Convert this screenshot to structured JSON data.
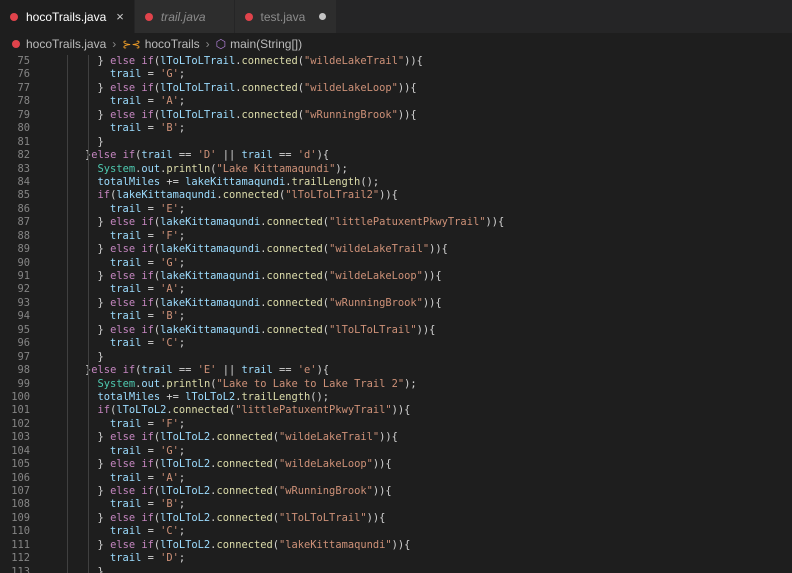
{
  "tabs": [
    {
      "label": "hocoTrails.java",
      "close": "×",
      "active": true
    },
    {
      "label": "trail.java",
      "active": false
    },
    {
      "label": "test.java",
      "active": false,
      "unsaved": true
    }
  ],
  "breadcrumb": {
    "file": "hocoTrails.java",
    "class": "hocoTrails",
    "method": "main(String[])"
  },
  "lines": [
    {
      "num": "75",
      "indent": "      ",
      "tokens": [
        [
          "op",
          "} "
        ],
        [
          "kw",
          "else if"
        ],
        [
          "op",
          "("
        ],
        [
          "var",
          "lToLToLTrail"
        ],
        [
          "op",
          "."
        ],
        [
          "fn",
          "connected"
        ],
        [
          "op",
          "("
        ],
        [
          "str",
          "\"wildeLakeTrail\""
        ],
        [
          "op",
          "))"
        ],
        [
          "op",
          "{"
        ]
      ]
    },
    {
      "num": "76",
      "indent": "        ",
      "tokens": [
        [
          "var",
          "trail"
        ],
        [
          "op",
          " = "
        ],
        [
          "str",
          "'G'"
        ],
        [
          "op",
          ";"
        ]
      ]
    },
    {
      "num": "77",
      "indent": "      ",
      "tokens": [
        [
          "op",
          "} "
        ],
        [
          "kw",
          "else if"
        ],
        [
          "op",
          "("
        ],
        [
          "var",
          "lToLToLTrail"
        ],
        [
          "op",
          "."
        ],
        [
          "fn",
          "connected"
        ],
        [
          "op",
          "("
        ],
        [
          "str",
          "\"wildeLakeLoop\""
        ],
        [
          "op",
          "))"
        ],
        [
          "op",
          "{"
        ]
      ]
    },
    {
      "num": "78",
      "indent": "        ",
      "tokens": [
        [
          "var",
          "trail"
        ],
        [
          "op",
          " = "
        ],
        [
          "str",
          "'A'"
        ],
        [
          "op",
          ";"
        ]
      ]
    },
    {
      "num": "79",
      "indent": "      ",
      "tokens": [
        [
          "op",
          "} "
        ],
        [
          "kw",
          "else if"
        ],
        [
          "op",
          "("
        ],
        [
          "var",
          "lToLToLTrail"
        ],
        [
          "op",
          "."
        ],
        [
          "fn",
          "connected"
        ],
        [
          "op",
          "("
        ],
        [
          "str",
          "\"wRunningBrook\""
        ],
        [
          "op",
          "))"
        ],
        [
          "op",
          "{"
        ]
      ]
    },
    {
      "num": "80",
      "indent": "        ",
      "tokens": [
        [
          "var",
          "trail"
        ],
        [
          "op",
          " = "
        ],
        [
          "str",
          "'B'"
        ],
        [
          "op",
          ";"
        ]
      ]
    },
    {
      "num": "81",
      "indent": "      ",
      "tokens": [
        [
          "op",
          "}"
        ]
      ]
    },
    {
      "num": "82",
      "indent": "    ",
      "tokens": [
        [
          "op",
          "}"
        ],
        [
          "kw",
          "else if"
        ],
        [
          "op",
          "("
        ],
        [
          "var",
          "trail"
        ],
        [
          "op",
          " == "
        ],
        [
          "str",
          "'D'"
        ],
        [
          "op",
          " || "
        ],
        [
          "var",
          "trail"
        ],
        [
          "op",
          " == "
        ],
        [
          "str",
          "'d'"
        ],
        [
          "op",
          "){"
        ]
      ]
    },
    {
      "num": "83",
      "indent": "      ",
      "tokens": [
        [
          "cls",
          "System"
        ],
        [
          "op",
          "."
        ],
        [
          "var",
          "out"
        ],
        [
          "op",
          "."
        ],
        [
          "fn",
          "println"
        ],
        [
          "op",
          "("
        ],
        [
          "str",
          "\"Lake Kittamaqundi\""
        ],
        [
          "op",
          ");"
        ]
      ]
    },
    {
      "num": "84",
      "indent": "      ",
      "tokens": [
        [
          "var",
          "totalMiles"
        ],
        [
          "op",
          " += "
        ],
        [
          "var",
          "lakeKittamaqundi"
        ],
        [
          "op",
          "."
        ],
        [
          "fn",
          "trailLength"
        ],
        [
          "op",
          "();"
        ]
      ]
    },
    {
      "num": "85",
      "indent": "      ",
      "tokens": [
        [
          "kw",
          "if"
        ],
        [
          "op",
          "("
        ],
        [
          "var",
          "lakeKittamaqundi"
        ],
        [
          "op",
          "."
        ],
        [
          "fn",
          "connected"
        ],
        [
          "op",
          "("
        ],
        [
          "str",
          "\"lToLToLTrail2\""
        ],
        [
          "op",
          "))"
        ],
        [
          "op",
          "{"
        ]
      ]
    },
    {
      "num": "86",
      "indent": "        ",
      "tokens": [
        [
          "var",
          "trail"
        ],
        [
          "op",
          " = "
        ],
        [
          "str",
          "'E'"
        ],
        [
          "op",
          ";"
        ]
      ]
    },
    {
      "num": "87",
      "indent": "      ",
      "tokens": [
        [
          "op",
          "} "
        ],
        [
          "kw",
          "else if"
        ],
        [
          "op",
          "("
        ],
        [
          "var",
          "lakeKittamaqundi"
        ],
        [
          "op",
          "."
        ],
        [
          "fn",
          "connected"
        ],
        [
          "op",
          "("
        ],
        [
          "str",
          "\"littlePatuxentPkwyTrail\""
        ],
        [
          "op",
          "))"
        ],
        [
          "op",
          "{"
        ]
      ]
    },
    {
      "num": "88",
      "indent": "        ",
      "tokens": [
        [
          "var",
          "trail"
        ],
        [
          "op",
          " = "
        ],
        [
          "str",
          "'F'"
        ],
        [
          "op",
          ";"
        ]
      ]
    },
    {
      "num": "89",
      "indent": "      ",
      "tokens": [
        [
          "op",
          "} "
        ],
        [
          "kw",
          "else if"
        ],
        [
          "op",
          "("
        ],
        [
          "var",
          "lakeKittamaqundi"
        ],
        [
          "op",
          "."
        ],
        [
          "fn",
          "connected"
        ],
        [
          "op",
          "("
        ],
        [
          "str",
          "\"wildeLakeTrail\""
        ],
        [
          "op",
          "))"
        ],
        [
          "op",
          "{"
        ]
      ]
    },
    {
      "num": "90",
      "indent": "        ",
      "tokens": [
        [
          "var",
          "trail"
        ],
        [
          "op",
          " = "
        ],
        [
          "str",
          "'G'"
        ],
        [
          "op",
          ";"
        ]
      ]
    },
    {
      "num": "91",
      "indent": "      ",
      "tokens": [
        [
          "op",
          "} "
        ],
        [
          "kw",
          "else if"
        ],
        [
          "op",
          "("
        ],
        [
          "var",
          "lakeKittamaqundi"
        ],
        [
          "op",
          "."
        ],
        [
          "fn",
          "connected"
        ],
        [
          "op",
          "("
        ],
        [
          "str",
          "\"wildeLakeLoop\""
        ],
        [
          "op",
          "))"
        ],
        [
          "op",
          "{"
        ]
      ]
    },
    {
      "num": "92",
      "indent": "        ",
      "tokens": [
        [
          "var",
          "trail"
        ],
        [
          "op",
          " = "
        ],
        [
          "str",
          "'A'"
        ],
        [
          "op",
          ";"
        ]
      ]
    },
    {
      "num": "93",
      "indent": "      ",
      "tokens": [
        [
          "op",
          "} "
        ],
        [
          "kw",
          "else if"
        ],
        [
          "op",
          "("
        ],
        [
          "var",
          "lakeKittamaqundi"
        ],
        [
          "op",
          "."
        ],
        [
          "fn",
          "connected"
        ],
        [
          "op",
          "("
        ],
        [
          "str",
          "\"wRunningBrook\""
        ],
        [
          "op",
          "))"
        ],
        [
          "op",
          "{"
        ]
      ]
    },
    {
      "num": "94",
      "indent": "        ",
      "tokens": [
        [
          "var",
          "trail"
        ],
        [
          "op",
          " = "
        ],
        [
          "str",
          "'B'"
        ],
        [
          "op",
          ";"
        ]
      ]
    },
    {
      "num": "95",
      "indent": "      ",
      "tokens": [
        [
          "op",
          "} "
        ],
        [
          "kw",
          "else if"
        ],
        [
          "op",
          "("
        ],
        [
          "var",
          "lakeKittamaqundi"
        ],
        [
          "op",
          "."
        ],
        [
          "fn",
          "connected"
        ],
        [
          "op",
          "("
        ],
        [
          "str",
          "\"lToLToLTrail\""
        ],
        [
          "op",
          "))"
        ],
        [
          "op",
          "{"
        ]
      ]
    },
    {
      "num": "96",
      "indent": "        ",
      "tokens": [
        [
          "var",
          "trail"
        ],
        [
          "op",
          " = "
        ],
        [
          "str",
          "'C'"
        ],
        [
          "op",
          ";"
        ]
      ]
    },
    {
      "num": "97",
      "indent": "      ",
      "tokens": [
        [
          "op",
          "}"
        ]
      ]
    },
    {
      "num": "98",
      "indent": "    ",
      "tokens": [
        [
          "op",
          "}"
        ],
        [
          "kw",
          "else if"
        ],
        [
          "op",
          "("
        ],
        [
          "var",
          "trail"
        ],
        [
          "op",
          " == "
        ],
        [
          "str",
          "'E'"
        ],
        [
          "op",
          " || "
        ],
        [
          "var",
          "trail"
        ],
        [
          "op",
          " == "
        ],
        [
          "str",
          "'e'"
        ],
        [
          "op",
          "){"
        ]
      ]
    },
    {
      "num": "99",
      "indent": "      ",
      "tokens": [
        [
          "cls",
          "System"
        ],
        [
          "op",
          "."
        ],
        [
          "var",
          "out"
        ],
        [
          "op",
          "."
        ],
        [
          "fn",
          "println"
        ],
        [
          "op",
          "("
        ],
        [
          "str",
          "\"Lake to Lake to Lake Trail 2\""
        ],
        [
          "op",
          ");"
        ]
      ]
    },
    {
      "num": "100",
      "indent": "      ",
      "tokens": [
        [
          "var",
          "totalMiles"
        ],
        [
          "op",
          " += "
        ],
        [
          "var",
          "lToLToL2"
        ],
        [
          "op",
          "."
        ],
        [
          "fn",
          "trailLength"
        ],
        [
          "op",
          "();"
        ]
      ]
    },
    {
      "num": "101",
      "indent": "      ",
      "tokens": [
        [
          "kw",
          "if"
        ],
        [
          "op",
          "("
        ],
        [
          "var",
          "lToLToL2"
        ],
        [
          "op",
          "."
        ],
        [
          "fn",
          "connected"
        ],
        [
          "op",
          "("
        ],
        [
          "str",
          "\"littlePatuxentPkwyTrail\""
        ],
        [
          "op",
          "))"
        ],
        [
          "op",
          "{"
        ]
      ]
    },
    {
      "num": "102",
      "indent": "        ",
      "tokens": [
        [
          "var",
          "trail"
        ],
        [
          "op",
          " = "
        ],
        [
          "str",
          "'F'"
        ],
        [
          "op",
          ";"
        ]
      ]
    },
    {
      "num": "103",
      "indent": "      ",
      "tokens": [
        [
          "op",
          "} "
        ],
        [
          "kw",
          "else if"
        ],
        [
          "op",
          "("
        ],
        [
          "var",
          "lToLToL2"
        ],
        [
          "op",
          "."
        ],
        [
          "fn",
          "connected"
        ],
        [
          "op",
          "("
        ],
        [
          "str",
          "\"wildeLakeTrail\""
        ],
        [
          "op",
          "))"
        ],
        [
          "op",
          "{"
        ]
      ]
    },
    {
      "num": "104",
      "indent": "        ",
      "tokens": [
        [
          "var",
          "trail"
        ],
        [
          "op",
          " = "
        ],
        [
          "str",
          "'G'"
        ],
        [
          "op",
          ";"
        ]
      ]
    },
    {
      "num": "105",
      "indent": "      ",
      "tokens": [
        [
          "op",
          "} "
        ],
        [
          "kw",
          "else if"
        ],
        [
          "op",
          "("
        ],
        [
          "var",
          "lToLToL2"
        ],
        [
          "op",
          "."
        ],
        [
          "fn",
          "connected"
        ],
        [
          "op",
          "("
        ],
        [
          "str",
          "\"wildeLakeLoop\""
        ],
        [
          "op",
          "))"
        ],
        [
          "op",
          "{"
        ]
      ]
    },
    {
      "num": "106",
      "indent": "        ",
      "tokens": [
        [
          "var",
          "trail"
        ],
        [
          "op",
          " = "
        ],
        [
          "str",
          "'A'"
        ],
        [
          "op",
          ";"
        ]
      ]
    },
    {
      "num": "107",
      "indent": "      ",
      "tokens": [
        [
          "op",
          "} "
        ],
        [
          "kw",
          "else if"
        ],
        [
          "op",
          "("
        ],
        [
          "var",
          "lToLToL2"
        ],
        [
          "op",
          "."
        ],
        [
          "fn",
          "connected"
        ],
        [
          "op",
          "("
        ],
        [
          "str",
          "\"wRunningBrook\""
        ],
        [
          "op",
          "))"
        ],
        [
          "op",
          "{"
        ]
      ]
    },
    {
      "num": "108",
      "indent": "        ",
      "tokens": [
        [
          "var",
          "trail"
        ],
        [
          "op",
          " = "
        ],
        [
          "str",
          "'B'"
        ],
        [
          "op",
          ";"
        ]
      ]
    },
    {
      "num": "109",
      "indent": "      ",
      "tokens": [
        [
          "op",
          "} "
        ],
        [
          "kw",
          "else if"
        ],
        [
          "op",
          "("
        ],
        [
          "var",
          "lToLToL2"
        ],
        [
          "op",
          "."
        ],
        [
          "fn",
          "connected"
        ],
        [
          "op",
          "("
        ],
        [
          "str",
          "\"lToLToLTrail\""
        ],
        [
          "op",
          "))"
        ],
        [
          "op",
          "{"
        ]
      ]
    },
    {
      "num": "110",
      "indent": "        ",
      "tokens": [
        [
          "var",
          "trail"
        ],
        [
          "op",
          " = "
        ],
        [
          "str",
          "'C'"
        ],
        [
          "op",
          ";"
        ]
      ]
    },
    {
      "num": "111",
      "indent": "      ",
      "tokens": [
        [
          "op",
          "} "
        ],
        [
          "kw",
          "else if"
        ],
        [
          "op",
          "("
        ],
        [
          "var",
          "lToLToL2"
        ],
        [
          "op",
          "."
        ],
        [
          "fn",
          "connected"
        ],
        [
          "op",
          "("
        ],
        [
          "str",
          "\"lakeKittamaqundi\""
        ],
        [
          "op",
          "))"
        ],
        [
          "op",
          "{"
        ]
      ]
    },
    {
      "num": "112",
      "indent": "        ",
      "tokens": [
        [
          "var",
          "trail"
        ],
        [
          "op",
          " = "
        ],
        [
          "str",
          "'D'"
        ],
        [
          "op",
          ";"
        ]
      ]
    },
    {
      "num": "113",
      "indent": "      ",
      "tokens": [
        [
          "op",
          "}"
        ]
      ]
    }
  ]
}
